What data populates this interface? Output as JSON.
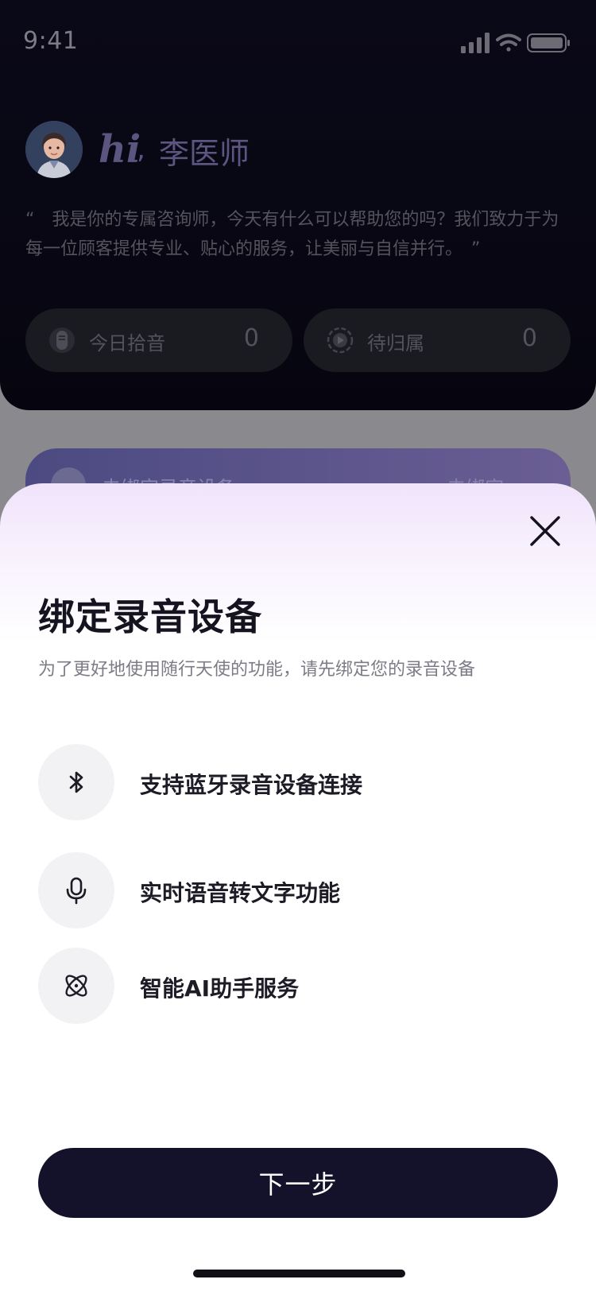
{
  "status_bar": {
    "time": "9:41"
  },
  "header": {
    "greeting_hi": "hi",
    "greeting_sep": ",",
    "doctor_name": "李医师",
    "intro_text": "“　我是你的专属咨询师，今天有什么可以帮助您的吗？我们致力于为每一位顾客提供专业、贴心的服务，让美丽与自信并行。　”"
  },
  "stats": [
    {
      "label": "今日拾音",
      "value": "0",
      "icon": "recorder-icon"
    },
    {
      "label": "待归属",
      "value": "0",
      "icon": "play-circle-icon"
    }
  ],
  "bind_banner": {
    "text": "去绑定录音设备",
    "action": "去绑定 >"
  },
  "sheet": {
    "title": "绑定录音设备",
    "subtitle": "为了更好地使用随行天使的功能，请先绑定您的录音设备",
    "features": [
      {
        "label": "支持蓝牙录音设备连接",
        "icon": "bluetooth-icon"
      },
      {
        "label": "实时语音转文字功能",
        "icon": "microphone-icon"
      },
      {
        "label": "智能AI助手服务",
        "icon": "atom-icon"
      }
    ],
    "next_button": "下一步"
  },
  "colors": {
    "sheet_button": "#14112a",
    "sheet_top_tint": "#f0e3fb",
    "background_panel": "#0a0918"
  }
}
